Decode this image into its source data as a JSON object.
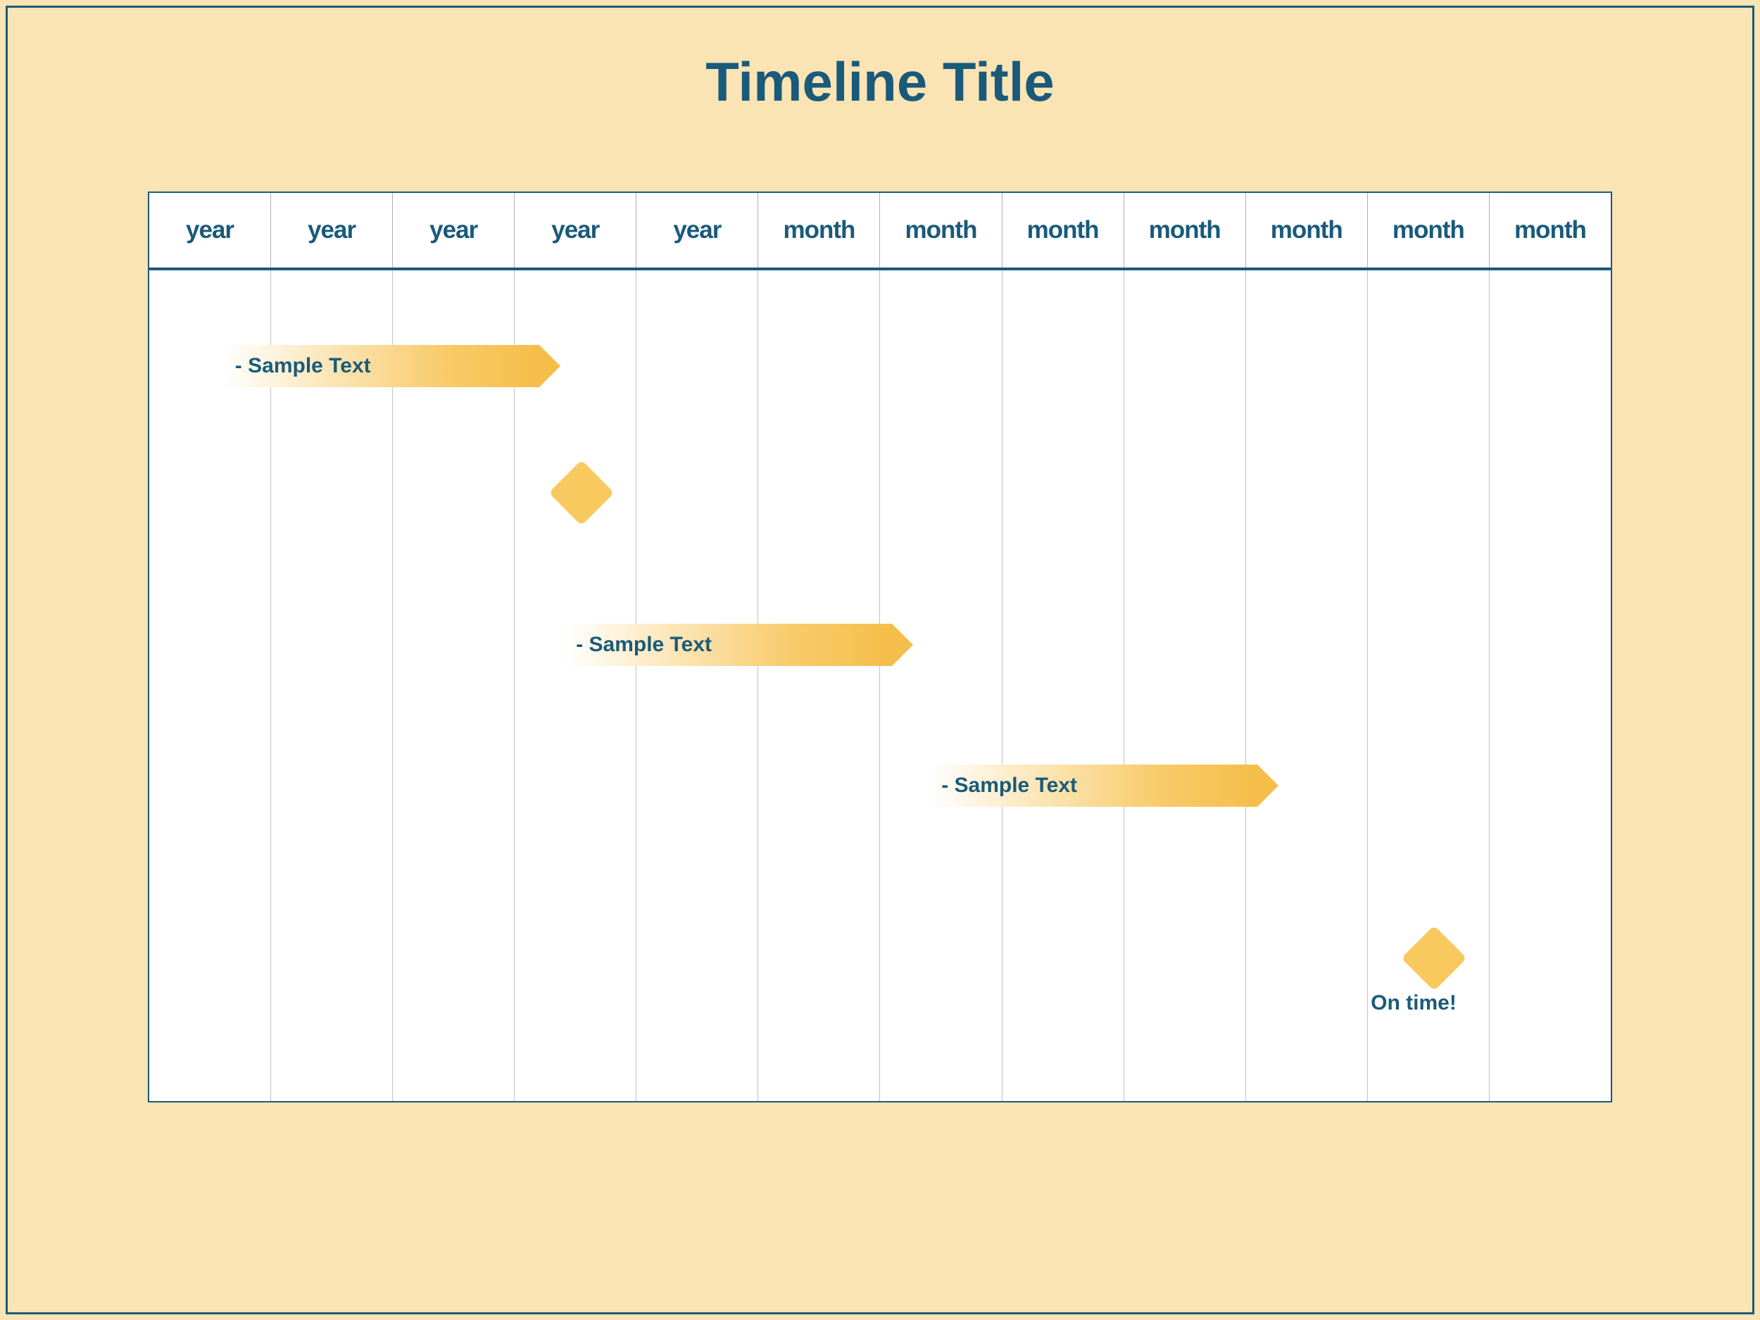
{
  "title": "Timeline Title",
  "columns": [
    "year",
    "year",
    "year",
    "year",
    "year",
    "month",
    "month",
    "month",
    "month",
    "month",
    "month",
    "month"
  ],
  "bars": [
    {
      "label": "- Sample Text",
      "start_col": 0.6,
      "end_col": 3.2,
      "row_pct": 9
    },
    {
      "label": "- Sample Text",
      "start_col": 3.4,
      "end_col": 6.1,
      "row_pct": 42.5
    },
    {
      "label": "- Sample Text",
      "start_col": 6.4,
      "end_col": 9.1,
      "row_pct": 59.5
    }
  ],
  "milestones": [
    {
      "col": 3.55,
      "row_pct": 24,
      "label": ""
    },
    {
      "col": 10.55,
      "row_pct": 80,
      "label": "On time!"
    }
  ],
  "colors": {
    "background": "#fae4b4",
    "accent": "#1a5a7a",
    "bar_fill": "#f8c95f"
  }
}
